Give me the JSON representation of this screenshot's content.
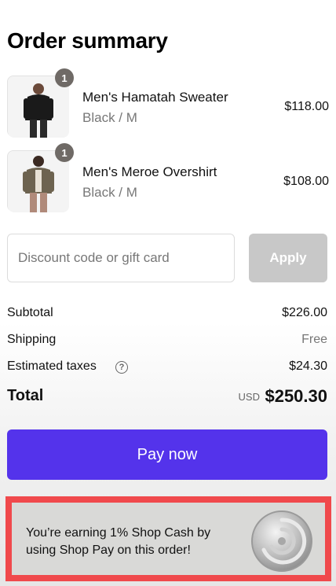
{
  "page_title": "Order summary",
  "items": [
    {
      "name": "Men's Hamatah Sweater",
      "variant": "Black / M",
      "price": "$118.00",
      "quantity": "1"
    },
    {
      "name": "Men's Meroe Overshirt",
      "variant": "Black / M",
      "price": "$108.00",
      "quantity": "1"
    }
  ],
  "discount": {
    "placeholder": "Discount code or gift card",
    "apply_label": "Apply"
  },
  "summary": {
    "subtotal_label": "Subtotal",
    "subtotal_value": "$226.00",
    "shipping_label": "Shipping",
    "shipping_value": "Free",
    "taxes_label": "Estimated taxes",
    "taxes_value": "$24.30",
    "total_label": "Total",
    "currency": "USD",
    "total_value": "$250.30"
  },
  "pay_button_label": "Pay now",
  "shop_cash": {
    "message": "You’re earning 1% Shop Cash by using Shop Pay on this order!"
  },
  "colors": {
    "pay_button": "#5433eb",
    "highlight_border": "#f0494c",
    "apply_disabled": "#c8c8c8"
  }
}
